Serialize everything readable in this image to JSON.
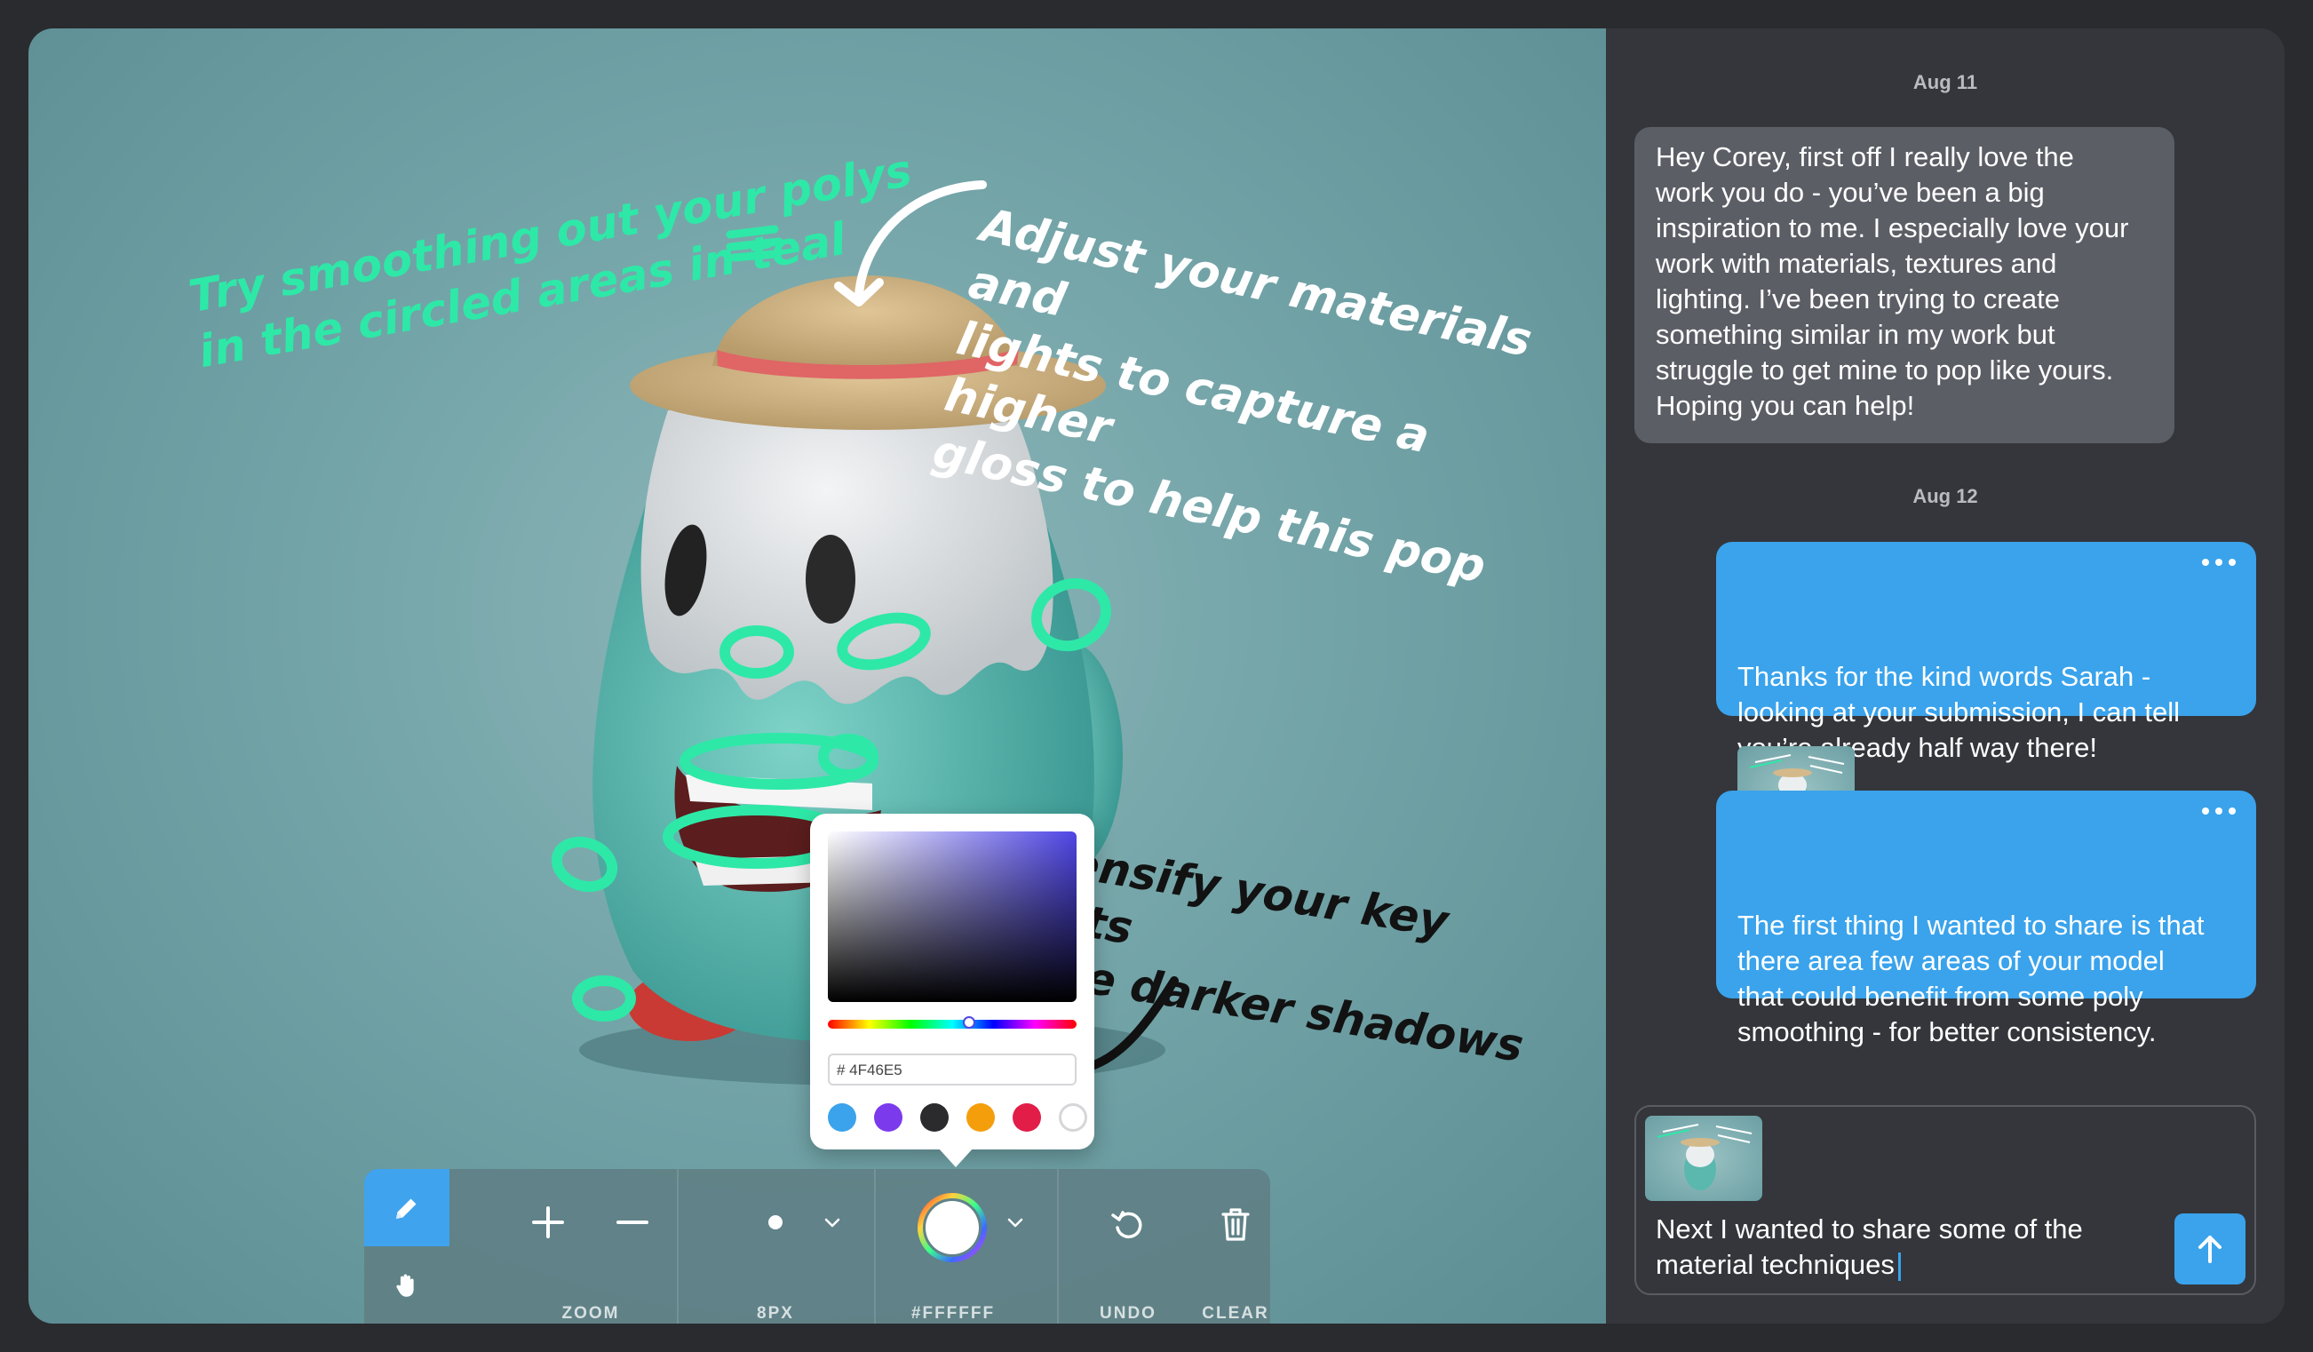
{
  "canvas": {
    "annotations": {
      "teal_note": "Try smoothing out your polys\nin the circled areas in teal",
      "white_note": "Adjust your materials and\nlights to capture a higher\ngloss to help this pop",
      "black_note": "Intensify your key lights\nsome darker shadows"
    },
    "color_picker": {
      "hex_value": "# 4F46E5",
      "swatches": [
        "#3aa3ec",
        "#7c3aed",
        "#2b2b2e",
        "#f59e0b",
        "#e11d48",
        "#ffffff"
      ],
      "selected_swatch": "#ffffff",
      "current_color": "#4F46E5"
    },
    "toolbar": {
      "zoom_label": "ZOOM",
      "size_label": "8PX",
      "color_label": "#FFFFFF",
      "undo_label": "UNDO",
      "clear_label": "CLEAR"
    }
  },
  "chat": {
    "date1": "Aug 11",
    "date2": "Aug 12",
    "messages": [
      {
        "direction": "incoming",
        "text": "Hey Corey, first off I really love the\nwork you do - you’ve been a big\ninspiration to me. I especially love your\nwork with materials, textures and\nlighting. I’ve been trying to create\nsomething similar in my work but\nstruggle to get mine to pop like yours.\nHoping you can help!"
      },
      {
        "direction": "outgoing",
        "text": "Thanks for the kind words Sarah -\nlooking at your submission, I can tell\nyou’re already half way there!"
      },
      {
        "direction": "outgoing",
        "text": "The first thing I wanted to share is that\nthere area few areas of your model\nthat could benefit from some poly\nsmoothing - for better consistency."
      }
    ],
    "composer": {
      "text": "Next I wanted to share some of the\nmaterial techniques"
    }
  },
  "colors": {
    "accent": "#3aa3ec",
    "teal_annotation": "#2ee8a7",
    "incoming_bubble": "#5c5e66",
    "background": "#34363b"
  }
}
